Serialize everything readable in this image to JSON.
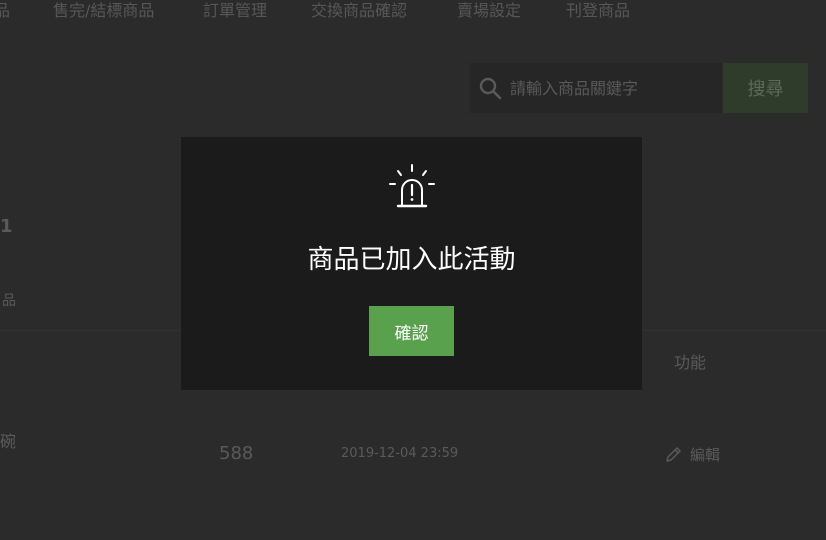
{
  "nav": {
    "items": [
      "品",
      "售完/結標商品",
      "訂單管理",
      "交換商品確認",
      "賣場設定",
      "刊登商品"
    ]
  },
  "search": {
    "placeholder": "請輸入商品關鍵字",
    "button_label": "搜尋"
  },
  "sidebar": {
    "fragments": [
      "1",
      "品",
      "碗"
    ]
  },
  "table": {
    "column_function": "功能",
    "row": {
      "number": "588",
      "datetime": "2019-12-04 23:59",
      "edit_label": "編輯"
    }
  },
  "modal": {
    "message": "商品已加入此活動",
    "confirm_label": "確認"
  },
  "colors": {
    "background": "#2b2b2b",
    "modal_background": "#1b1b1b",
    "confirm_button": "#5aa14e",
    "search_button_dimmed": "#2f3c2b"
  }
}
